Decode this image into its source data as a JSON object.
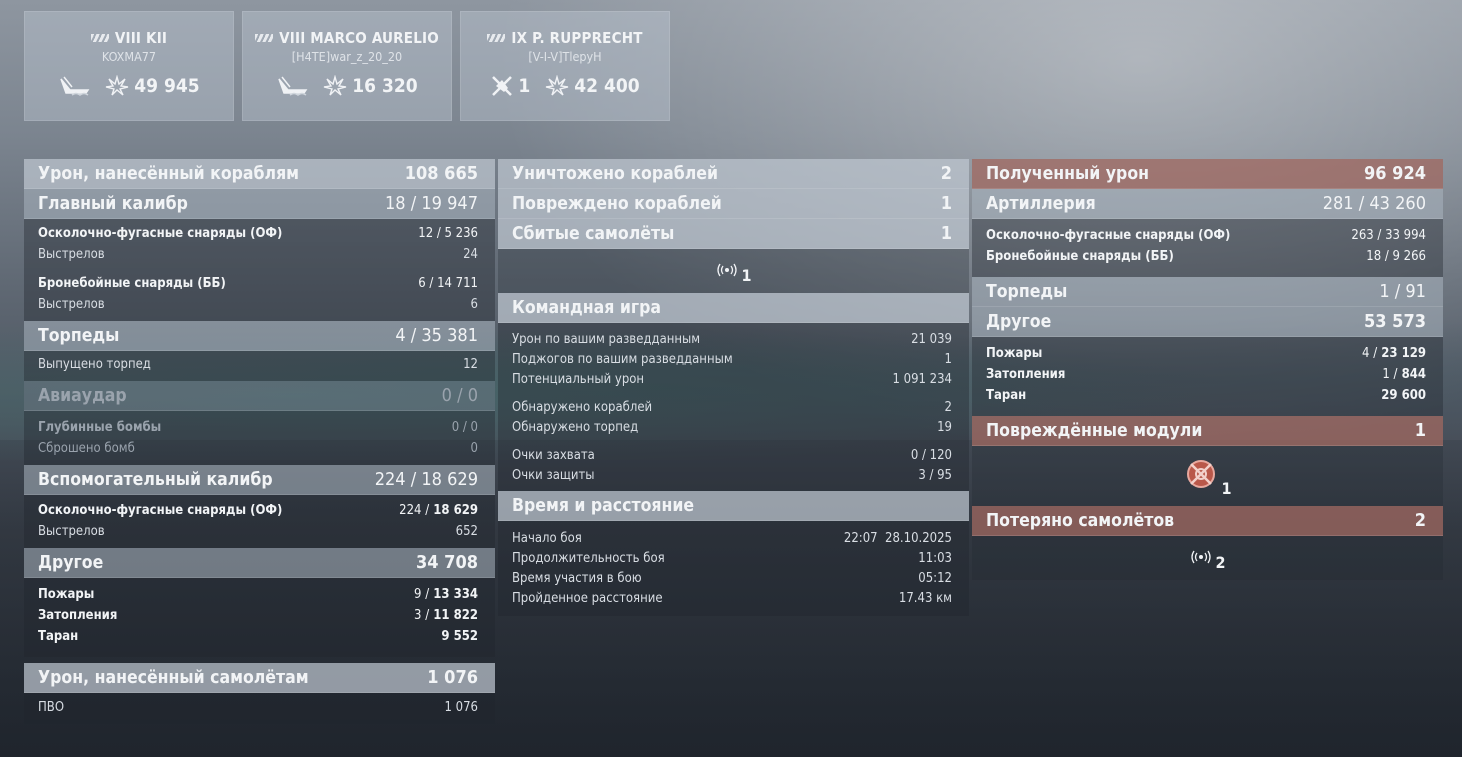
{
  "ships": [
    {
      "tier_name": "VIII KII",
      "player": "KOXMA77",
      "kills": "",
      "damage": "49 945"
    },
    {
      "tier_name": "VIII MARCO AURELIO",
      "player": "[H4TE]war_z_20_20",
      "kills": "",
      "damage": "16 320"
    },
    {
      "tier_name": "IX P. RUPPRECHT",
      "player": "[V-I-V]TlepyH",
      "kills": "1",
      "damage": "42 400"
    }
  ],
  "damage_dealt": {
    "title": "Урон, нанесённый кораблям",
    "total": "108 665",
    "main_battery": {
      "label": "Главный калибр",
      "value": "18 / 19 947",
      "he_label": "Осколочно-фугасные снаряды (ОФ)",
      "he_value": "12 / 5 236",
      "he_shots_label": "Выстрелов",
      "he_shots": "24",
      "ap_label": "Бронебойные снаряды (ББ)",
      "ap_value": "6 / 14 711",
      "ap_shots_label": "Выстрелов",
      "ap_shots": "6"
    },
    "torpedoes": {
      "label": "Торпеды",
      "value": "4 / 35 381",
      "launched_label": "Выпущено торпед",
      "launched": "12"
    },
    "airstrike": {
      "label": "Авиаудар",
      "value": "0 / 0",
      "depth_label": "Глубинные бомбы",
      "depth_value": "0 / 0",
      "dropped_label": "Сброшено бомб",
      "dropped": "0"
    },
    "secondary": {
      "label": "Вспомогательный калибр",
      "value": "224 / 18 629",
      "he_label": "Осколочно-фугасные снаряды (ОФ)",
      "he_value_a": "224 /",
      "he_value_b": "18 629",
      "shots_label": "Выстрелов",
      "shots": "652"
    },
    "other": {
      "label": "Другое",
      "value": "34 708",
      "fires_label": "Пожары",
      "fires_a": "9 /",
      "fires_b": "13 334",
      "flood_label": "Затопления",
      "flood_a": "3 /",
      "flood_b": "11 822",
      "ram_label": "Таран",
      "ram": "9 552"
    }
  },
  "aircraft_damage": {
    "title": "Урон, нанесённый самолётам",
    "total": "1 076",
    "aa_label": "ПВО",
    "aa_value": "1 076"
  },
  "middle": {
    "destroyed_label": "Уничтожено кораблей",
    "destroyed": "2",
    "damaged_label": "Повреждено кораблей",
    "damaged": "1",
    "planes_label": "Сбитые самолёты",
    "planes": "1",
    "planes_icon_count": "1",
    "team": {
      "title": "Командная игра",
      "spot_dmg_label": "Урон по вашим разведданным",
      "spot_dmg": "21 039",
      "spot_fires_label": "Поджогов по вашим разведданным",
      "spot_fires": "1",
      "potential_label": "Потенциальный урон",
      "potential": "1 091 234",
      "ships_spotted_label": "Обнаружено кораблей",
      "ships_spotted": "2",
      "torps_spotted_label": "Обнаружено торпед",
      "torps_spotted": "19",
      "capture_label": "Очки захвата",
      "capture": "0 / 120",
      "defense_label": "Очки защиты",
      "defense": "3 / 95"
    },
    "time": {
      "title": "Время и расстояние",
      "start_label": "Начало боя",
      "start": "22:07  28.10.2025",
      "duration_label": "Продолжительность боя",
      "duration": "11:03",
      "participation_label": "Время участия в бою",
      "participation": "05:12",
      "distance_label": "Пройденное расстояние",
      "distance": "17.43 км"
    }
  },
  "received": {
    "title": "Полученный урон",
    "total": "96 924",
    "artillery": {
      "label": "Артиллерия",
      "value": "281 / 43 260",
      "he_label": "Осколочно-фугасные снаряды (ОФ)",
      "he_value": "263 / 33 994",
      "ap_label": "Бронебойные снаряды (ББ)",
      "ap_value": "18 / 9 266"
    },
    "torpedoes": {
      "label": "Торпеды",
      "value": "1 / 91"
    },
    "other": {
      "label": "Другое",
      "value": "53 573",
      "fires_label": "Пожары",
      "fires_a": "4 /",
      "fires_b": "23 129",
      "flood_label": "Затопления",
      "flood_a": "1 /",
      "flood_b": "844",
      "ram_label": "Таран",
      "ram": "29 600"
    },
    "modules": {
      "label": "Повреждённые модули",
      "value": "1",
      "icon_count": "1"
    },
    "planes_lost": {
      "label": "Потеряно самолётов",
      "value": "2",
      "icon_count": "2"
    }
  },
  "colors": {
    "header_red": "#a06860",
    "header_grey": "#aab4c0"
  }
}
